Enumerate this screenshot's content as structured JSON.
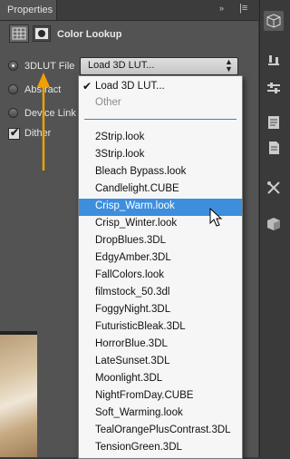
{
  "panel": {
    "tab_label": "Properties",
    "tab_close": "×",
    "collapse_glyph": "»",
    "menu_glyph": "≡",
    "title": "Color Lookup"
  },
  "options": [
    {
      "label": "3DLUT File",
      "selected": true
    },
    {
      "label": "Abstract",
      "selected": false
    },
    {
      "label": "Device Link",
      "selected": false
    }
  ],
  "dither": {
    "label": "Dither",
    "checked": true
  },
  "selector": {
    "value": "Load 3D LUT...",
    "arrow": "⬍"
  },
  "dropdown": {
    "top_items": [
      {
        "label": "Load 3D LUT...",
        "checked": true,
        "disabled": false
      },
      {
        "label": "Other",
        "checked": false,
        "disabled": true
      }
    ],
    "items": [
      "2Strip.look",
      "3Strip.look",
      "Bleach Bypass.look",
      "Candlelight.CUBE",
      "Crisp_Warm.look",
      "Crisp_Winter.look",
      "DropBlues.3DL",
      "EdgyAmber.3DL",
      "FallColors.look",
      "filmstock_50.3dl",
      "FoggyNight.3DL",
      "FuturisticBleak.3DL",
      "HorrorBlue.3DL",
      "LateSunset.3DL",
      "Moonlight.3DL",
      "NightFromDay.CUBE",
      "Soft_Warming.look",
      "TealOrangePlusContrast.3DL",
      "TensionGreen.3DL"
    ],
    "highlighted": "Crisp_Warm.look"
  },
  "toolbar_icons": [
    "3d-cube-icon",
    "brush-settings-icon",
    "adjust-sliders-icon",
    "notes-icon",
    "document-icon",
    "tools-icon",
    "cube-icon"
  ],
  "colors": {
    "highlight": "#3e8ede",
    "panel": "#535353",
    "arrow": "#f0a000"
  }
}
